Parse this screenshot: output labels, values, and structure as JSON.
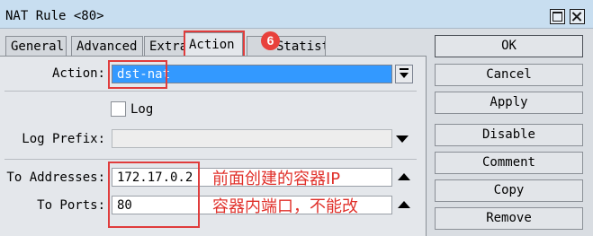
{
  "window": {
    "title": "NAT Rule <80>"
  },
  "tabs": [
    {
      "label": "General"
    },
    {
      "label": "Advanced"
    },
    {
      "label": "Extra"
    },
    {
      "label": "Action"
    },
    {
      "label": "Statistics"
    }
  ],
  "step_badge": "6",
  "action": {
    "label": "Action:",
    "value": "dst-nat"
  },
  "log": {
    "label": "Log",
    "checked": false
  },
  "log_prefix": {
    "label": "Log Prefix:",
    "value": ""
  },
  "to_addresses": {
    "label": "To Addresses:",
    "value": "172.17.0.2"
  },
  "to_ports": {
    "label": "To Ports:",
    "value": "80"
  },
  "annotations": {
    "addresses_note": "前面创建的容器IP",
    "ports_note": "容器内端口，不能改"
  },
  "buttons": [
    "OK",
    "Cancel",
    "Apply",
    "Disable",
    "Comment",
    "Copy",
    "Remove"
  ],
  "colors": {
    "selection": "#3399ff",
    "annotation": "#e0302a",
    "titlebar": "#c8def0"
  }
}
